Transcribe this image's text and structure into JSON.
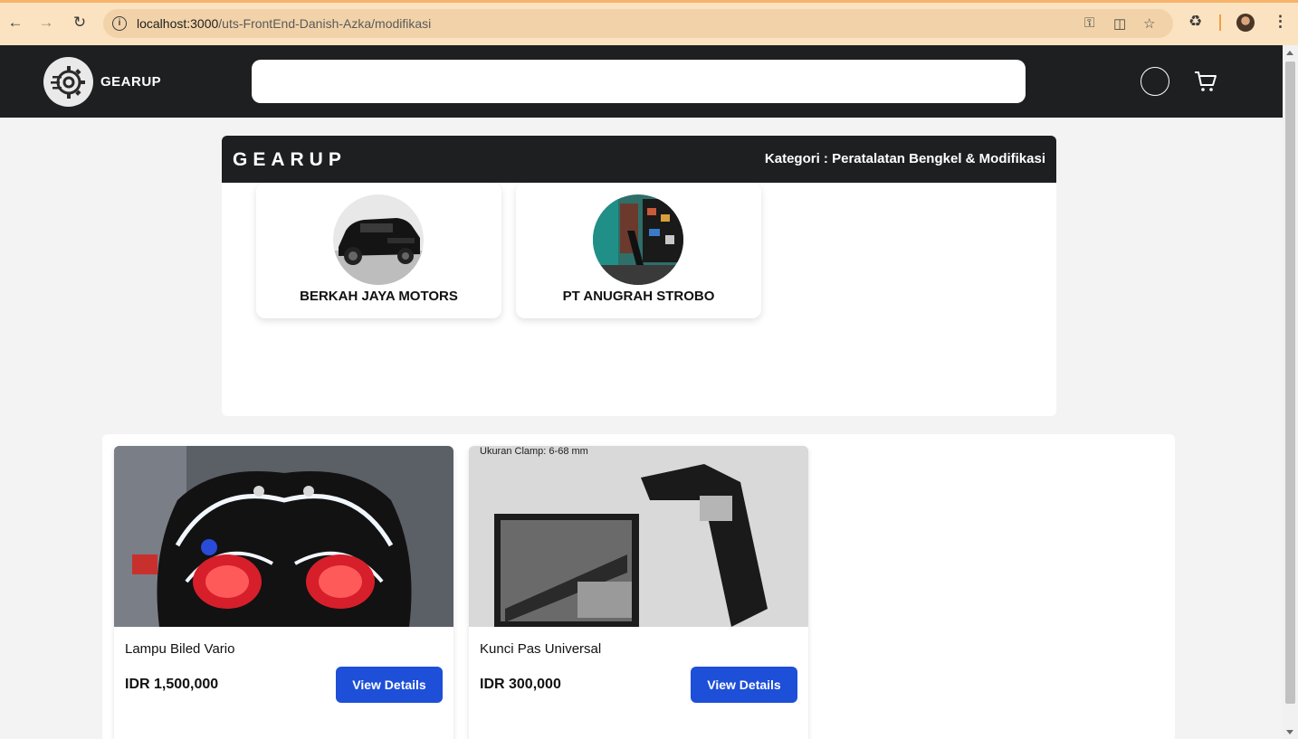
{
  "browser": {
    "url_host": "localhost:3000",
    "url_path": "/uts-FrontEnd-Danish-Azka/modifikasi"
  },
  "header": {
    "brand": "GEARUP",
    "search_placeholder": ""
  },
  "category_panel": {
    "brand": "GEARUP",
    "category_label": "Kategori : Peratalatan Bengkel & Modifikasi",
    "shops": [
      {
        "name": "BERKAH JAYA MOTORS"
      },
      {
        "name": "PT ANUGRAH STROBO"
      }
    ]
  },
  "products": [
    {
      "name": "Lampu Biled Vario",
      "price": "IDR 1,500,000",
      "button": "View Details"
    },
    {
      "name": "Kunci Pas Universal",
      "price": "IDR 300,000",
      "button": "View Details",
      "image_caption": "Ukuran Clamp: 6-68 mm"
    }
  ],
  "colors": {
    "header_bg": "#1e1f21",
    "button_bg": "#1d4fd8",
    "chrome_bg": "#fbe3c1"
  }
}
